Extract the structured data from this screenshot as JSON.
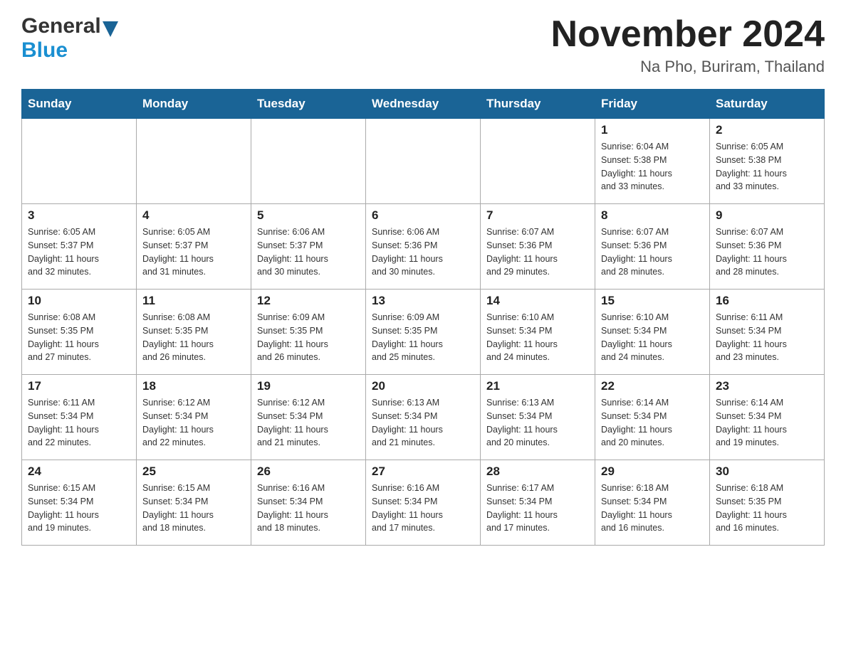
{
  "header": {
    "logo_general": "General",
    "logo_blue": "Blue",
    "month_year": "November 2024",
    "location": "Na Pho, Buriram, Thailand"
  },
  "days_of_week": [
    "Sunday",
    "Monday",
    "Tuesday",
    "Wednesday",
    "Thursday",
    "Friday",
    "Saturday"
  ],
  "weeks": [
    {
      "days": [
        {
          "num": "",
          "info": ""
        },
        {
          "num": "",
          "info": ""
        },
        {
          "num": "",
          "info": ""
        },
        {
          "num": "",
          "info": ""
        },
        {
          "num": "",
          "info": ""
        },
        {
          "num": "1",
          "info": "Sunrise: 6:04 AM\nSunset: 5:38 PM\nDaylight: 11 hours\nand 33 minutes."
        },
        {
          "num": "2",
          "info": "Sunrise: 6:05 AM\nSunset: 5:38 PM\nDaylight: 11 hours\nand 33 minutes."
        }
      ]
    },
    {
      "days": [
        {
          "num": "3",
          "info": "Sunrise: 6:05 AM\nSunset: 5:37 PM\nDaylight: 11 hours\nand 32 minutes."
        },
        {
          "num": "4",
          "info": "Sunrise: 6:05 AM\nSunset: 5:37 PM\nDaylight: 11 hours\nand 31 minutes."
        },
        {
          "num": "5",
          "info": "Sunrise: 6:06 AM\nSunset: 5:37 PM\nDaylight: 11 hours\nand 30 minutes."
        },
        {
          "num": "6",
          "info": "Sunrise: 6:06 AM\nSunset: 5:36 PM\nDaylight: 11 hours\nand 30 minutes."
        },
        {
          "num": "7",
          "info": "Sunrise: 6:07 AM\nSunset: 5:36 PM\nDaylight: 11 hours\nand 29 minutes."
        },
        {
          "num": "8",
          "info": "Sunrise: 6:07 AM\nSunset: 5:36 PM\nDaylight: 11 hours\nand 28 minutes."
        },
        {
          "num": "9",
          "info": "Sunrise: 6:07 AM\nSunset: 5:36 PM\nDaylight: 11 hours\nand 28 minutes."
        }
      ]
    },
    {
      "days": [
        {
          "num": "10",
          "info": "Sunrise: 6:08 AM\nSunset: 5:35 PM\nDaylight: 11 hours\nand 27 minutes."
        },
        {
          "num": "11",
          "info": "Sunrise: 6:08 AM\nSunset: 5:35 PM\nDaylight: 11 hours\nand 26 minutes."
        },
        {
          "num": "12",
          "info": "Sunrise: 6:09 AM\nSunset: 5:35 PM\nDaylight: 11 hours\nand 26 minutes."
        },
        {
          "num": "13",
          "info": "Sunrise: 6:09 AM\nSunset: 5:35 PM\nDaylight: 11 hours\nand 25 minutes."
        },
        {
          "num": "14",
          "info": "Sunrise: 6:10 AM\nSunset: 5:34 PM\nDaylight: 11 hours\nand 24 minutes."
        },
        {
          "num": "15",
          "info": "Sunrise: 6:10 AM\nSunset: 5:34 PM\nDaylight: 11 hours\nand 24 minutes."
        },
        {
          "num": "16",
          "info": "Sunrise: 6:11 AM\nSunset: 5:34 PM\nDaylight: 11 hours\nand 23 minutes."
        }
      ]
    },
    {
      "days": [
        {
          "num": "17",
          "info": "Sunrise: 6:11 AM\nSunset: 5:34 PM\nDaylight: 11 hours\nand 22 minutes."
        },
        {
          "num": "18",
          "info": "Sunrise: 6:12 AM\nSunset: 5:34 PM\nDaylight: 11 hours\nand 22 minutes."
        },
        {
          "num": "19",
          "info": "Sunrise: 6:12 AM\nSunset: 5:34 PM\nDaylight: 11 hours\nand 21 minutes."
        },
        {
          "num": "20",
          "info": "Sunrise: 6:13 AM\nSunset: 5:34 PM\nDaylight: 11 hours\nand 21 minutes."
        },
        {
          "num": "21",
          "info": "Sunrise: 6:13 AM\nSunset: 5:34 PM\nDaylight: 11 hours\nand 20 minutes."
        },
        {
          "num": "22",
          "info": "Sunrise: 6:14 AM\nSunset: 5:34 PM\nDaylight: 11 hours\nand 20 minutes."
        },
        {
          "num": "23",
          "info": "Sunrise: 6:14 AM\nSunset: 5:34 PM\nDaylight: 11 hours\nand 19 minutes."
        }
      ]
    },
    {
      "days": [
        {
          "num": "24",
          "info": "Sunrise: 6:15 AM\nSunset: 5:34 PM\nDaylight: 11 hours\nand 19 minutes."
        },
        {
          "num": "25",
          "info": "Sunrise: 6:15 AM\nSunset: 5:34 PM\nDaylight: 11 hours\nand 18 minutes."
        },
        {
          "num": "26",
          "info": "Sunrise: 6:16 AM\nSunset: 5:34 PM\nDaylight: 11 hours\nand 18 minutes."
        },
        {
          "num": "27",
          "info": "Sunrise: 6:16 AM\nSunset: 5:34 PM\nDaylight: 11 hours\nand 17 minutes."
        },
        {
          "num": "28",
          "info": "Sunrise: 6:17 AM\nSunset: 5:34 PM\nDaylight: 11 hours\nand 17 minutes."
        },
        {
          "num": "29",
          "info": "Sunrise: 6:18 AM\nSunset: 5:34 PM\nDaylight: 11 hours\nand 16 minutes."
        },
        {
          "num": "30",
          "info": "Sunrise: 6:18 AM\nSunset: 5:35 PM\nDaylight: 11 hours\nand 16 minutes."
        }
      ]
    }
  ]
}
